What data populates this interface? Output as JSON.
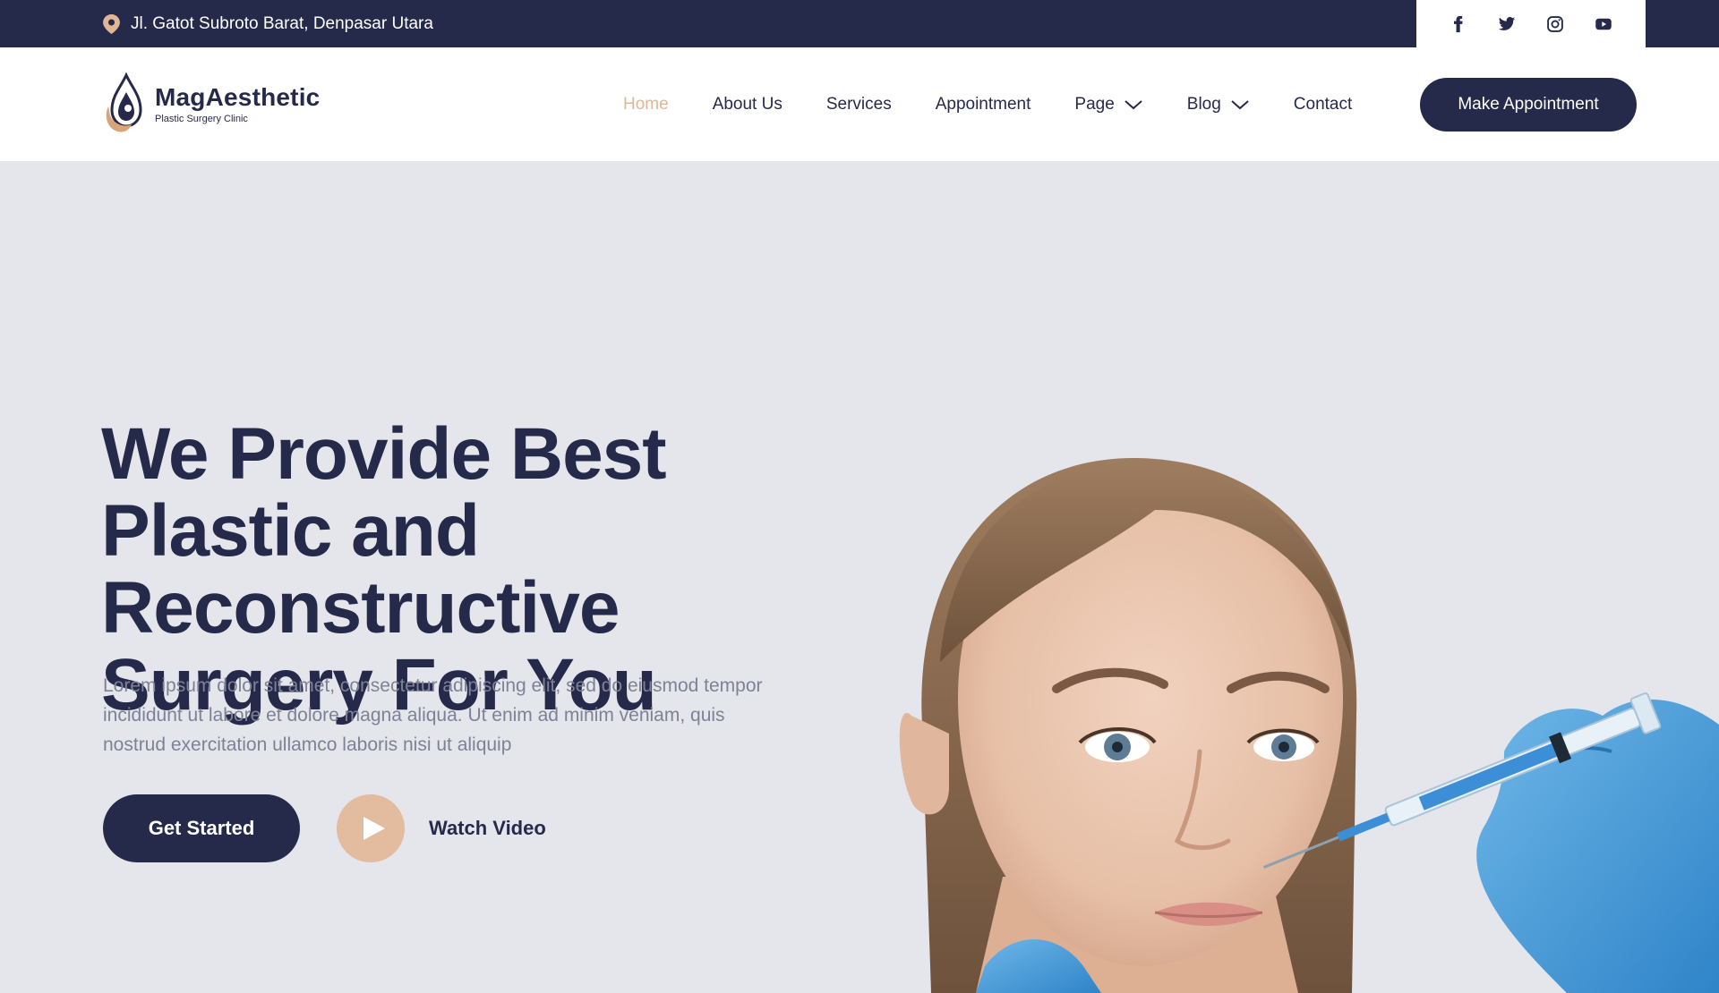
{
  "topbar": {
    "address": "Jl. Gatot Subroto Barat, Denpasar Utara",
    "socials": [
      "facebook-icon",
      "twitter-icon",
      "instagram-icon",
      "youtube-icon"
    ]
  },
  "header": {
    "brand": "MagAesthetic",
    "tagline": "Plastic Surgery Clinic",
    "nav": {
      "home": "Home",
      "about": "About Us",
      "services": "Services",
      "appointment": "Appointment",
      "page": "Page",
      "blog": "Blog",
      "contact": "Contact"
    },
    "cta": "Make Appointment"
  },
  "hero": {
    "title": "We Provide Best Plastic and Reconstructive Surgery For You",
    "text": "Lorem ipsum dolor sit amet, consectetur adipiscing elit, sed do eiusmod tempor incididunt ut labore et dolore magna aliqua. Ut enim ad minim veniam, quis nostrud exercitation ullamco laboris nisi ut aliquip",
    "get_started": "Get Started",
    "watch_video": "Watch Video"
  },
  "colors": {
    "navy": "#262A4A",
    "accent": "#E0B697",
    "background": "#E4E6EB",
    "body_text": "#7E8296"
  }
}
